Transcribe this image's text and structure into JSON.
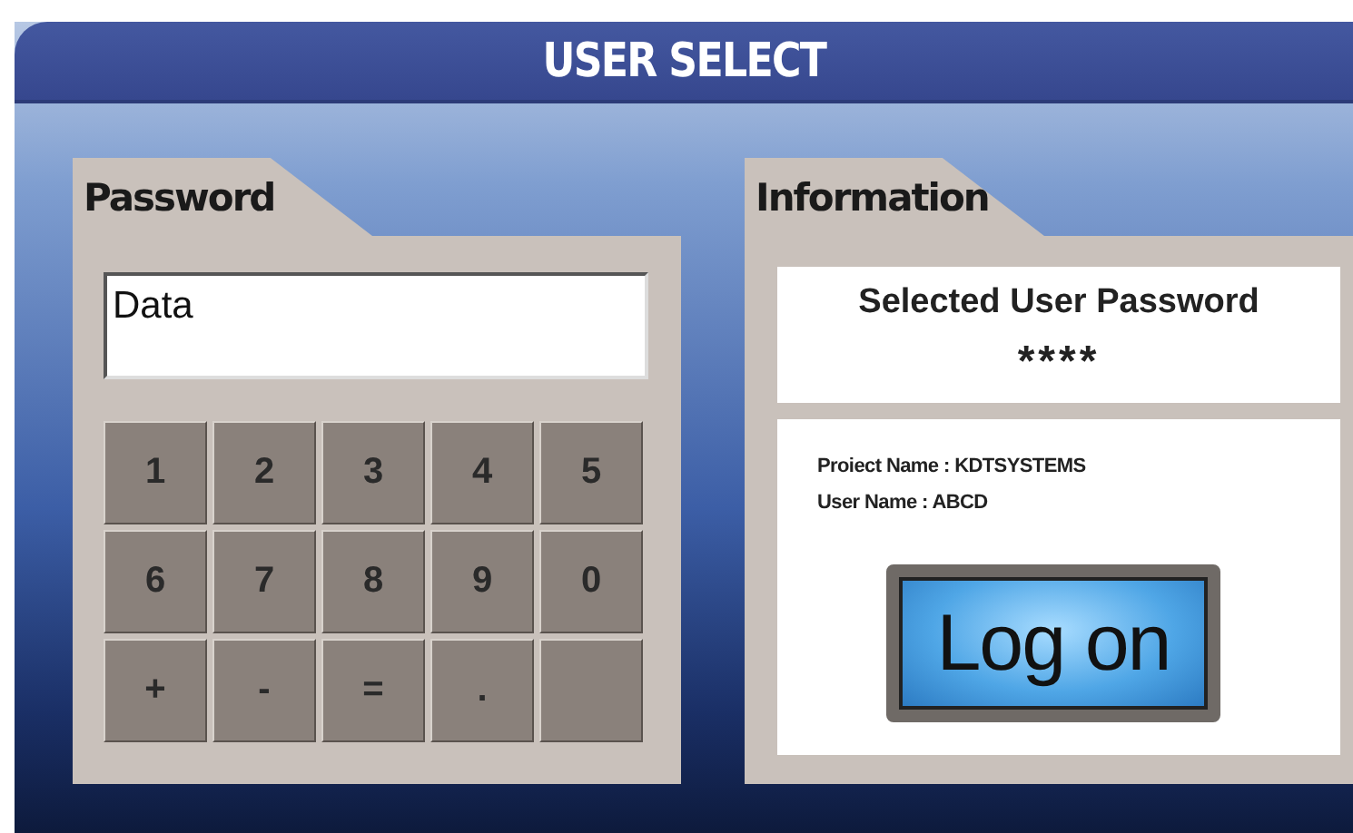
{
  "header": {
    "title": "USER SELECT"
  },
  "password_panel": {
    "tab": "Password",
    "field": {
      "value": "Data"
    },
    "keys": [
      "1",
      "2",
      "3",
      "4",
      "5",
      "6",
      "7",
      "8",
      "9",
      "0",
      "+",
      "-",
      "=",
      "."
    ]
  },
  "information_panel": {
    "tab": "Information",
    "selected_user_password": {
      "label": "Selected User Password",
      "value": "****"
    },
    "details": [
      "Proiect Name : KDTSYSTEMS",
      "User Name : ABCD"
    ],
    "logon_button": "Log on"
  }
}
